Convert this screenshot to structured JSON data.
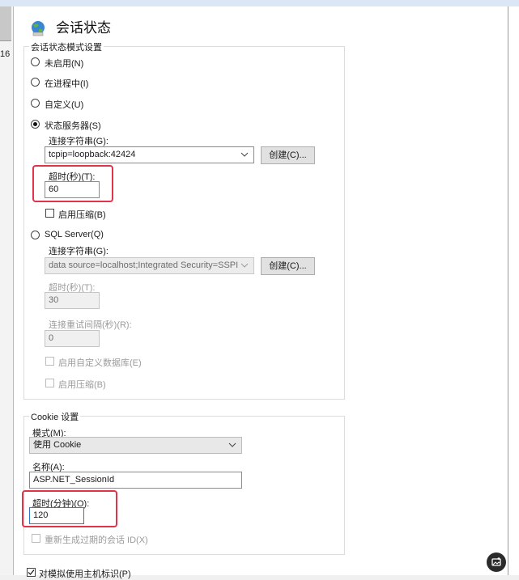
{
  "header": {
    "title": "会话状态",
    "icon": "globe-icon"
  },
  "left_edge_text": "16",
  "session_mode": {
    "legend": "会话状态模式设置",
    "options": [
      "未启用(N)",
      "在进程中(I)",
      "自定义(U)",
      "状态服务器(S)",
      "SQL Server(Q)"
    ],
    "selected": "状态服务器(S)"
  },
  "state_server": {
    "conn_label": "连接字符串(G):",
    "conn_value": "tcpip=loopback:42424",
    "create_button": "创建(C)...",
    "timeout_label": "超时(秒)(T):",
    "timeout_value": "60",
    "compress_label": "启用压缩(B)"
  },
  "sql_server": {
    "conn_label": "连接字符串(G):",
    "conn_value": "data source=localhost;Integrated Security=SSPI",
    "create_button": "创建(C)...",
    "timeout_label": "超时(秒)(T):",
    "timeout_value": "30",
    "retry_label": "连接重试间隔(秒)(R):",
    "retry_value": "0",
    "custom_db_label": "启用自定义数据库(E)",
    "compress_label": "启用压缩(B)"
  },
  "cookie": {
    "legend": "Cookie 设置",
    "mode_label": "模式(M):",
    "mode_value": "使用 Cookie",
    "name_label": "名称(A):",
    "name_value": "ASP.NET_SessionId",
    "timeout_label": "超时(分钟)(O):",
    "timeout_value": "120",
    "regen_label": "重新生成过期的会话 ID(X)"
  },
  "bottom_checkbox_label": "对模拟使用主机标识(P)",
  "accent_red": "#e0344a",
  "accent_blue": "#2f78c4"
}
